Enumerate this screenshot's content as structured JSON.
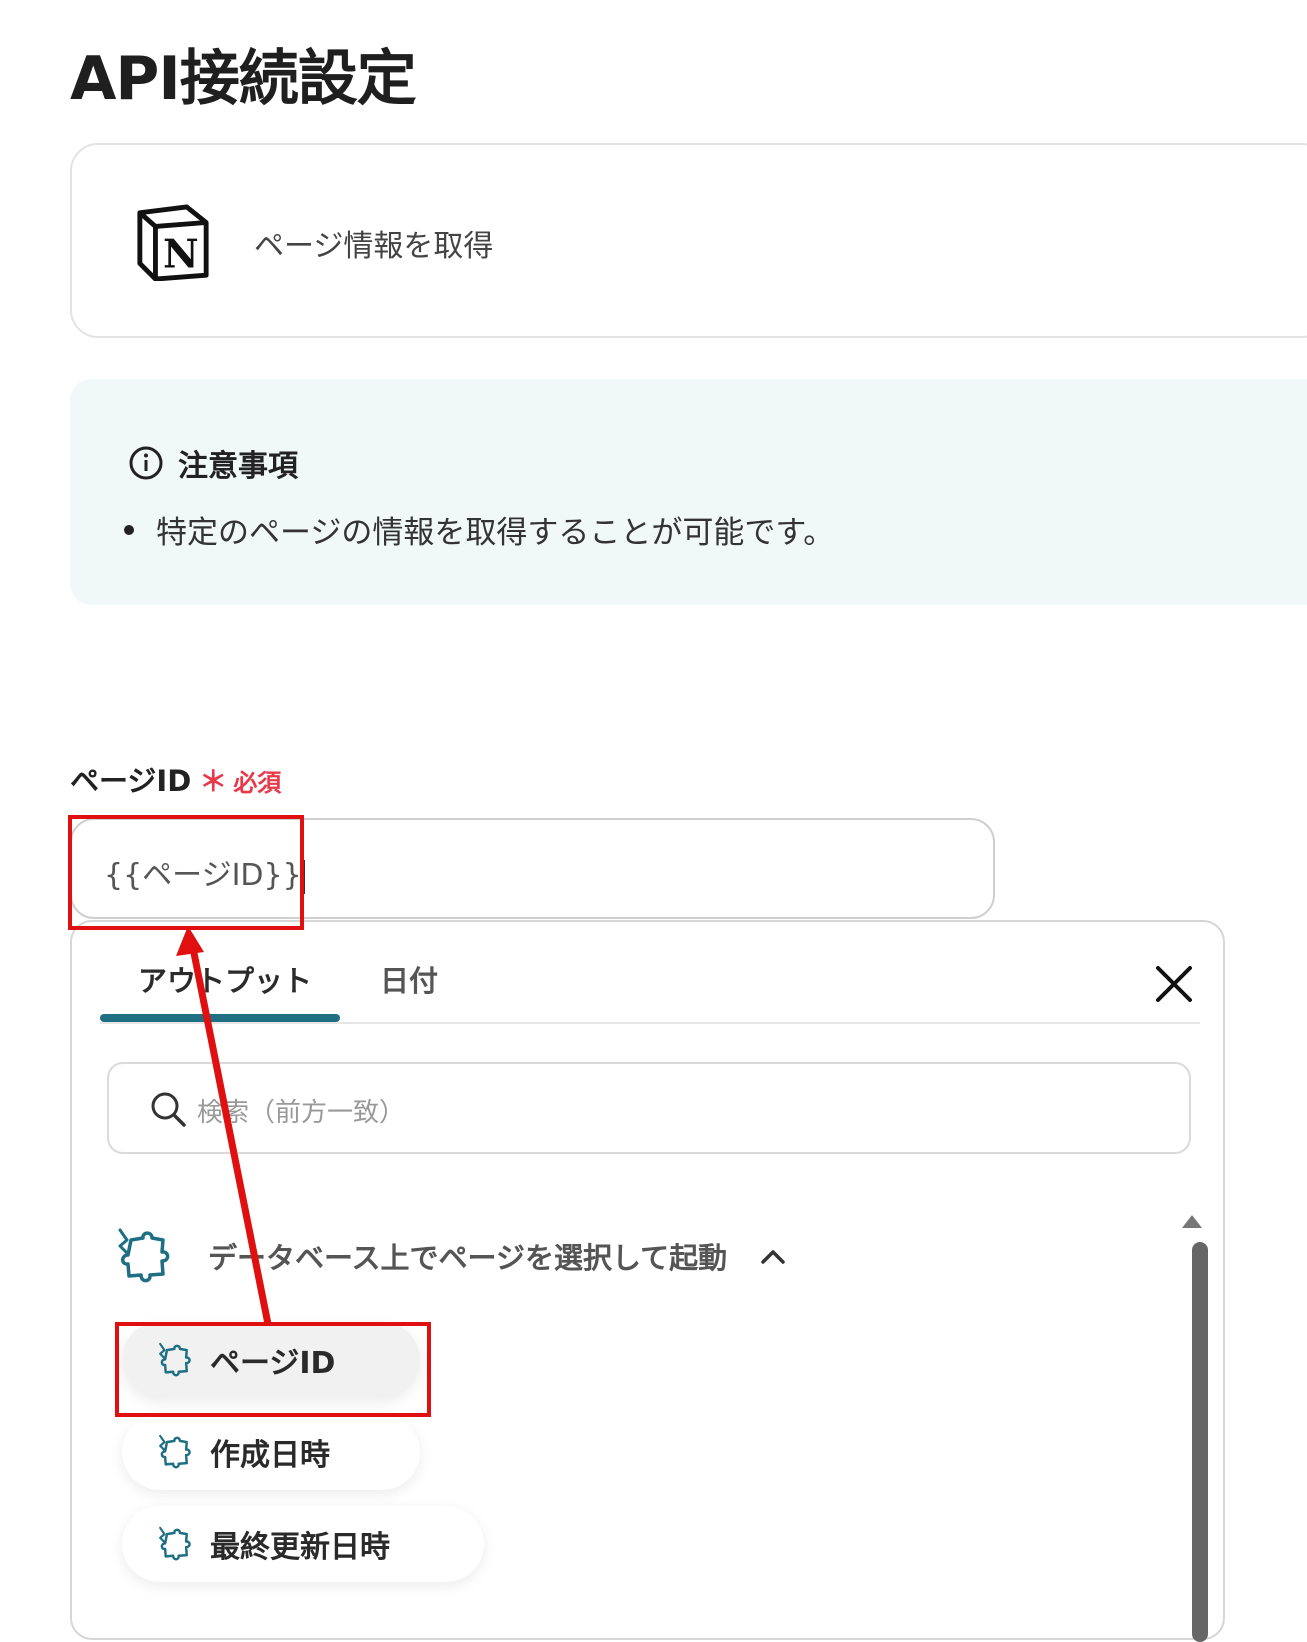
{
  "page": {
    "title": "API接続設定"
  },
  "action": {
    "app_icon": "notion-logo",
    "label": "ページ情報を取得"
  },
  "notice": {
    "icon": "info-icon",
    "title": "注意事項",
    "items": [
      "特定のページの情報を取得することが可能です。"
    ]
  },
  "field": {
    "label": "ページID",
    "required_mark": "＊",
    "required_text": "必須",
    "value": "{{ページID}}"
  },
  "dropdown": {
    "tabs": [
      {
        "label": "アウトプット",
        "active": true
      },
      {
        "label": "日付",
        "active": false
      }
    ],
    "close_icon": "close-icon",
    "search": {
      "placeholder": "検索（前方一致）"
    },
    "group": {
      "label": "データベース上でページを選択して起動",
      "icon": "puzzle-icon",
      "expanded": true,
      "items": [
        {
          "label": "ページID",
          "selected": true
        },
        {
          "label": "作成日時",
          "selected": false
        },
        {
          "label": "最終更新日時",
          "selected": false
        }
      ]
    }
  },
  "colors": {
    "accent": "#1f6f84",
    "required": "#e8394a",
    "annotation": "#e01010",
    "notice_bg": "#f0f8f8"
  }
}
